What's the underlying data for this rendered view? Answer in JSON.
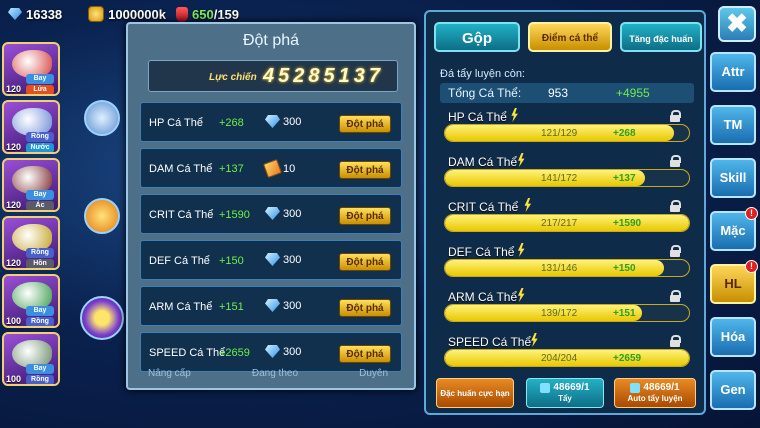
{
  "top_bar": {
    "gems": "16338",
    "gold": "1000000k",
    "stamina_current": "650",
    "stamina_max": "/159"
  },
  "team": [
    {
      "level": "120",
      "tags": [
        "Bay",
        "Lửa"
      ],
      "color": "#d64040"
    },
    {
      "level": "120",
      "tags": [
        "Rồng",
        "Nước"
      ],
      "color": "#6a8ad6"
    },
    {
      "level": "120",
      "tags": [
        "Bay",
        "Ác"
      ],
      "color": "#7a2a2a"
    },
    {
      "level": "120",
      "tags": [
        "Rồng",
        "Hồn"
      ],
      "color": "#c0a020"
    },
    {
      "level": "100",
      "tags": [
        "Bay",
        "Rồng"
      ],
      "color": "#3a9a4a"
    },
    {
      "level": "100",
      "tags": [
        "Bay",
        "Rồng"
      ],
      "color": "#6a8a6a"
    }
  ],
  "breakthrough": {
    "title": "Đột phá",
    "power_label": "Lực chiến",
    "power_value": "45285137",
    "rows": [
      {
        "name": "HP Cá Thể",
        "bonus": "+268",
        "cost": "300",
        "currency": "diamond-icon",
        "button": "Đột phá"
      },
      {
        "name": "DAM Cá Thể",
        "bonus": "+137",
        "cost": "10",
        "currency": "scroll-icon",
        "button": "Đột phá"
      },
      {
        "name": "CRIT Cá Thể",
        "bonus": "+1590",
        "cost": "300",
        "currency": "diamond-icon",
        "button": "Đột phá"
      },
      {
        "name": "DEF Cá Thể",
        "bonus": "+150",
        "cost": "300",
        "currency": "diamond-icon",
        "button": "Đột phá"
      },
      {
        "name": "ARM Cá Thể",
        "bonus": "+151",
        "cost": "300",
        "currency": "diamond-icon",
        "button": "Đột phá"
      },
      {
        "name": "SPEED Cá Thể",
        "bonus": "+2659",
        "cost": "300",
        "currency": "diamond-icon",
        "button": "Đột phá"
      }
    ],
    "bottom_nav": [
      "Nâng cấp",
      "Đang theo",
      "Duyên"
    ]
  },
  "stats_panel": {
    "tabs": [
      "Gộp",
      "Điểm cá thể",
      "Tăng đặc huấn"
    ],
    "remain_label": "Đá tẩy luyện còn:",
    "total_label": "Tổng Cá Thể:",
    "total_value": "953",
    "total_bonus": "+4955",
    "stats": [
      {
        "name": "HP Cá Thể",
        "current": 121,
        "max": 129,
        "progress_text": "121/129",
        "bonus": "+268"
      },
      {
        "name": "DAM Cá Thể",
        "current": 141,
        "max": 172,
        "progress_text": "141/172",
        "bonus": "+137"
      },
      {
        "name": "CRIT Cá Thể",
        "current": 217,
        "max": 217,
        "progress_text": "217/217",
        "bonus": "+1590"
      },
      {
        "name": "DEF Cá Thể",
        "current": 131,
        "max": 146,
        "progress_text": "131/146",
        "bonus": "+150"
      },
      {
        "name": "ARM Cá Thể",
        "current": 139,
        "max": 172,
        "progress_text": "139/172",
        "bonus": "+151"
      },
      {
        "name": "SPEED Cá Thể",
        "current": 204,
        "max": 204,
        "progress_text": "204/204",
        "bonus": "+2659"
      }
    ],
    "btn_special": "Đặc huấn cực hạn",
    "btn_wash_count": "48669/1",
    "btn_wash_label": "Tẩy",
    "btn_auto_count": "48669/1",
    "btn_auto_label": "Auto tẩy luyện"
  },
  "right_nav": [
    {
      "label": "Attr",
      "badge": ""
    },
    {
      "label": "TM",
      "badge": ""
    },
    {
      "label": "Skill",
      "badge": ""
    },
    {
      "label": "Mặc",
      "badge": "!"
    },
    {
      "label": "HL",
      "badge": "!",
      "active": true
    },
    {
      "label": "Hóa",
      "badge": ""
    },
    {
      "label": "Gen",
      "badge": ""
    }
  ],
  "close_label": "✖"
}
